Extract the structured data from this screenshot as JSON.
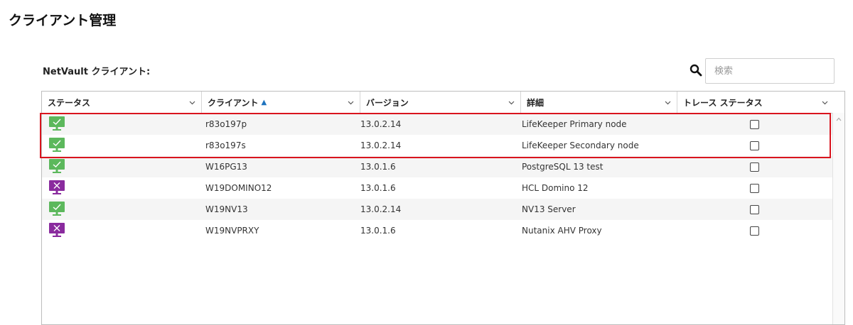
{
  "page": {
    "title": "クライアント管理"
  },
  "section": {
    "label": "NetVault クライアント:"
  },
  "search": {
    "placeholder": "検索",
    "value": ""
  },
  "table": {
    "columns": [
      {
        "label": "ステータス",
        "sorted": false
      },
      {
        "label": "クライアント",
        "sorted": true,
        "sort_direction": "ascending"
      },
      {
        "label": "バージョン",
        "sorted": false
      },
      {
        "label": "詳細",
        "sorted": false
      },
      {
        "label": "トレース ステータス",
        "sorted": false
      }
    ],
    "sort_indicator": "▲",
    "rows": [
      {
        "status": "online",
        "client": "r83o197p",
        "version": "13.0.2.14",
        "detail": "LifeKeeper Primary node",
        "trace": false
      },
      {
        "status": "online",
        "client": "r83o197s",
        "version": "13.0.2.14",
        "detail": "LifeKeeper Secondary node",
        "trace": false
      },
      {
        "status": "online",
        "client": "W16PG13",
        "version": "13.0.1.6",
        "detail": "PostgreSQL 13 test",
        "trace": false
      },
      {
        "status": "offline",
        "client": "W19DOMINO12",
        "version": "13.0.1.6",
        "detail": "HCL Domino 12",
        "trace": false
      },
      {
        "status": "online",
        "client": "W19NV13",
        "version": "13.0.2.14",
        "detail": "NV13 Server",
        "trace": false
      },
      {
        "status": "offline",
        "client": "W19NVPRXY",
        "version": "13.0.1.6",
        "detail": "Nutanix AHV Proxy",
        "trace": false
      }
    ]
  },
  "icons": {
    "status_online": "monitor-check-icon",
    "status_offline": "monitor-x-icon",
    "search": "search-icon",
    "column_menu": "chevron-down-icon"
  },
  "colors": {
    "online": "#5cb85c",
    "offline": "#8a2b9e",
    "highlight": "#d9141e",
    "sort_arrow": "#1e73be"
  }
}
